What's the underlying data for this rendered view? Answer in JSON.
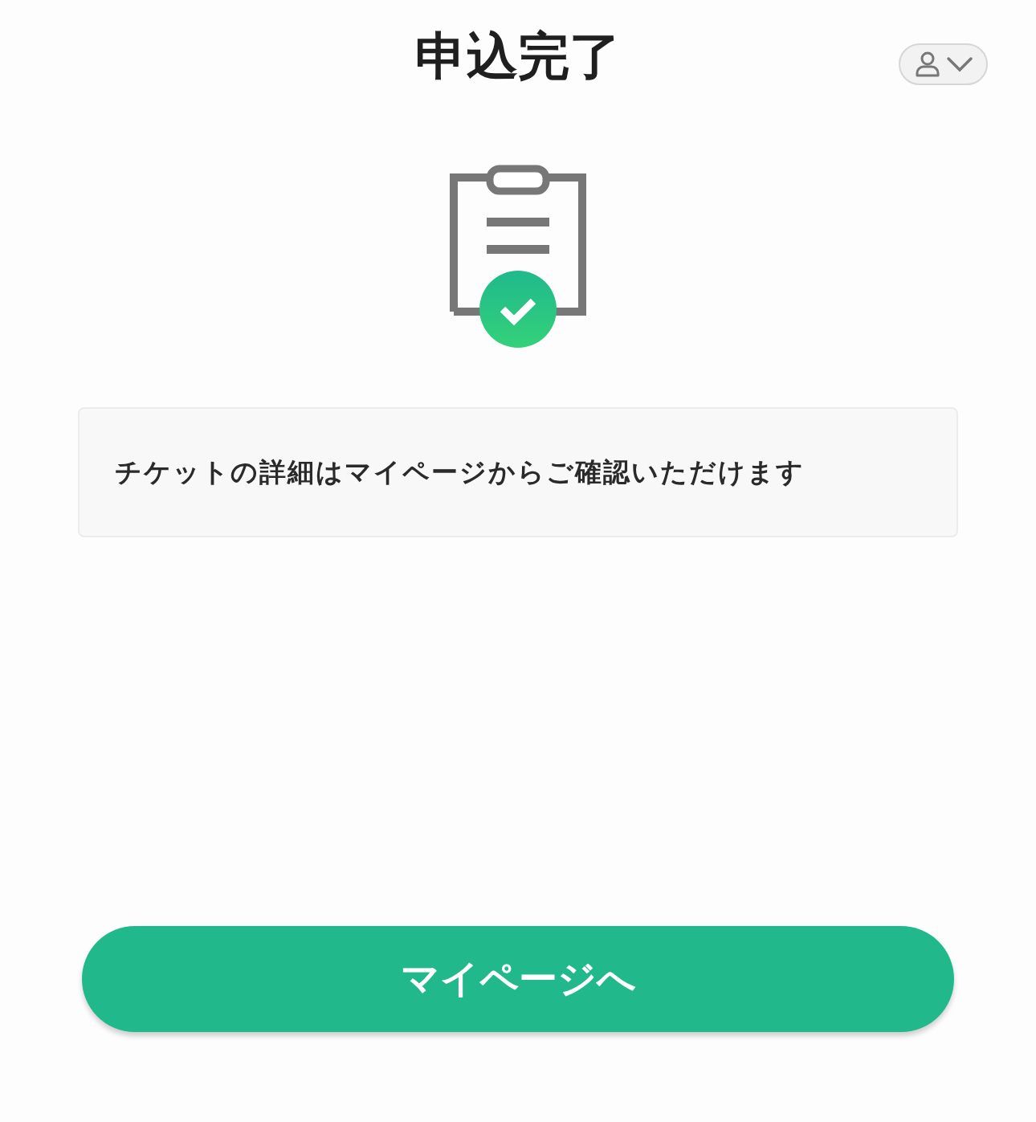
{
  "header": {
    "title": "申込完了"
  },
  "message": "チケットの詳細はマイページからご確認いただけます",
  "button": {
    "label": "マイページへ"
  }
}
